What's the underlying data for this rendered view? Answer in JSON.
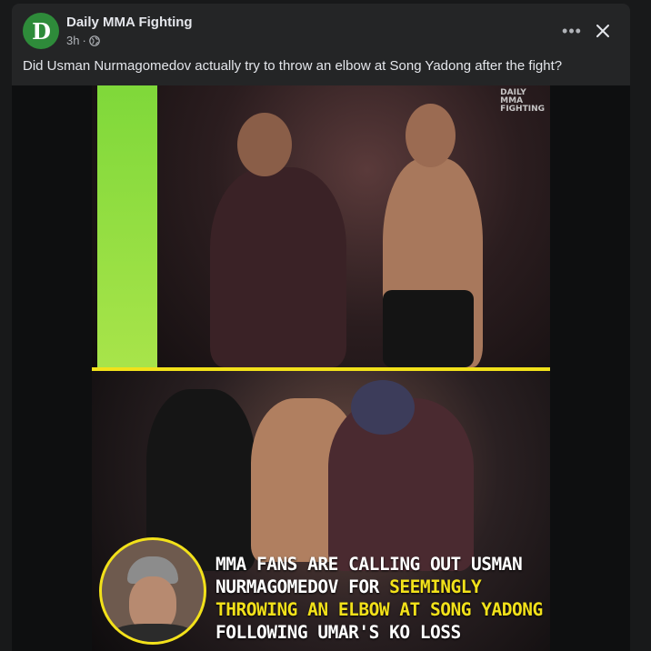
{
  "post": {
    "page_name": "Daily MMA Fighting",
    "avatar_letter": "D",
    "time": "3h",
    "dot": "·",
    "more_label": "•••",
    "caption": "Did Usman Nurmagomedov actually try to throw an elbow at Song Yadong after the fight?"
  },
  "image": {
    "watermark": "DAILY\nMMA\nFIGHTING",
    "headline_parts": [
      {
        "text": "MMA FANS ARE CALLING OUT USMAN ",
        "highlight": false
      },
      {
        "text": "NURMAGOMEDOV FOR ",
        "highlight": false
      },
      {
        "text": "SEEMINGLY THROWING AN ELBOW AT SONG YADONG",
        "highlight": true
      },
      {
        "text": " FOLLOWING UMAR'S KO LOSS",
        "highlight": false
      }
    ]
  },
  "colors": {
    "background": "#18191a",
    "card": "#242526",
    "accent_yellow": "#f2e11a",
    "avatar_green": "#2e8b3a"
  },
  "icons": [
    "globe-icon",
    "more-icon",
    "close-icon"
  ]
}
